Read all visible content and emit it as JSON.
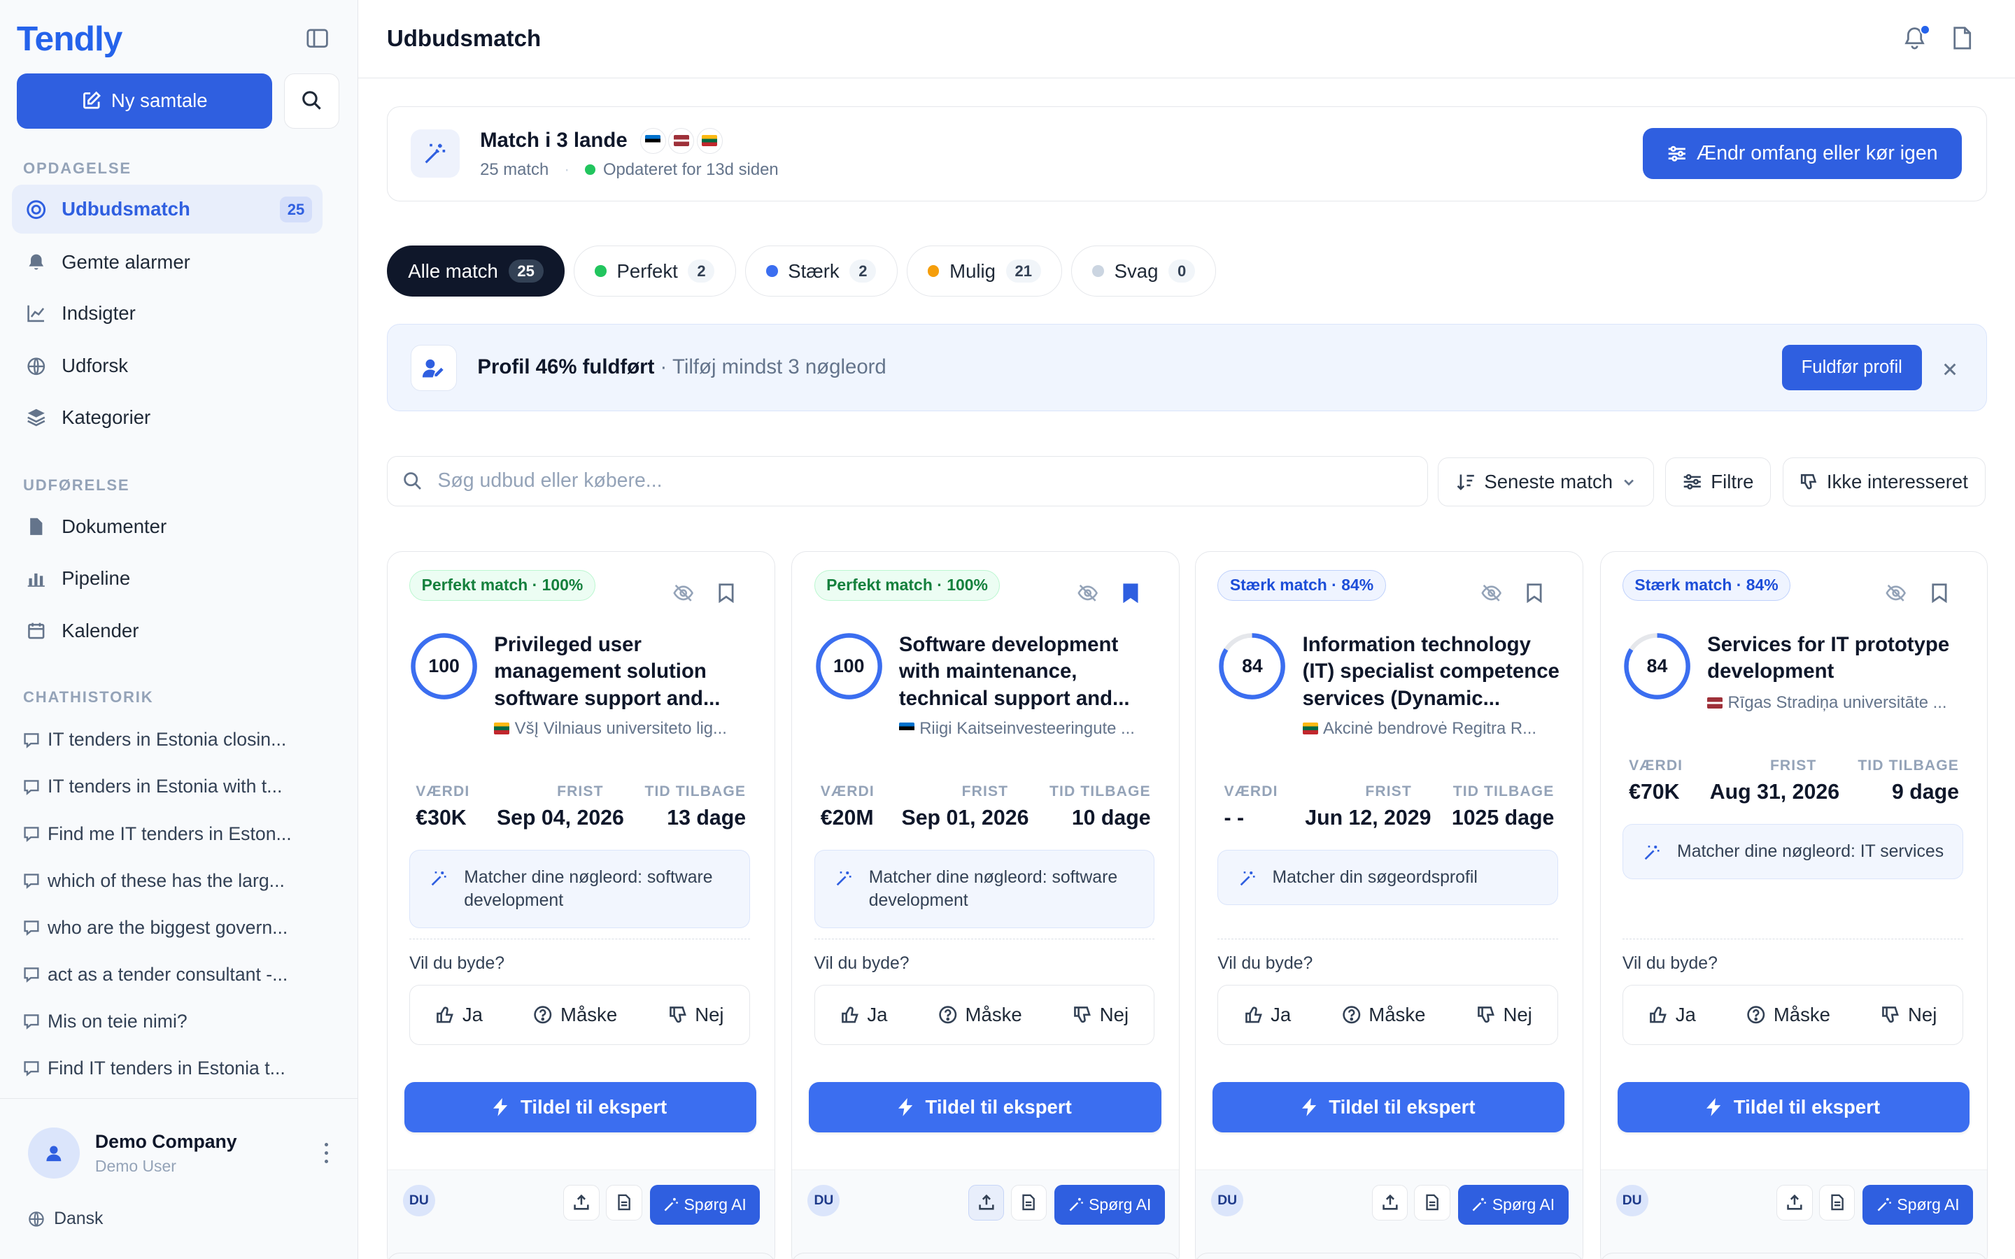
{
  "app": {
    "logo": "Tendly"
  },
  "sidebar": {
    "new_chat": "Ny samtale",
    "sections": {
      "discovery": "OPDAGELSE",
      "execution": "UDFØRELSE",
      "history": "CHATHISTORIK"
    },
    "nav": [
      {
        "label": "Udbudsmatch",
        "badge": "25",
        "icon": "target-icon"
      },
      {
        "label": "Gemte alarmer",
        "icon": "bell-icon"
      },
      {
        "label": "Indsigter",
        "icon": "line-chart-icon"
      },
      {
        "label": "Udforsk",
        "icon": "globe-icon"
      },
      {
        "label": "Kategorier",
        "icon": "layers-icon"
      }
    ],
    "exec_nav": [
      {
        "label": "Dokumenter",
        "icon": "document-icon"
      },
      {
        "label": "Pipeline",
        "icon": "bar-chart-icon"
      },
      {
        "label": "Kalender",
        "icon": "calendar-icon"
      }
    ],
    "history": [
      "IT tenders in Estonia closin...",
      "IT tenders in Estonia with t...",
      "Find me IT tenders in Eston...",
      "which of these has the larg...",
      "who are the biggest govern...",
      "act as a tender consultant -...",
      "Mis on teie nimi?",
      "Find IT tenders in Estonia t..."
    ],
    "footer": {
      "company": "Demo Company",
      "user": "Demo User",
      "language": "Dansk"
    }
  },
  "header": {
    "title": "Udbudsmatch"
  },
  "match_summary": {
    "title": "Match i 3 lande",
    "count": "25 match",
    "separator": "·",
    "updated": "Opdateret for 13d siden",
    "button": "Ændr omfang eller kør igen"
  },
  "filters": [
    {
      "label": "Alle match",
      "count": "25",
      "active": true
    },
    {
      "label": "Perfekt",
      "count": "2",
      "color": "#22c55e"
    },
    {
      "label": "Stærk",
      "count": "2",
      "color": "#3b6ef0"
    },
    {
      "label": "Mulig",
      "count": "21",
      "color": "#f59e0b"
    },
    {
      "label": "Svag",
      "count": "0",
      "color": "#cbd5e1"
    }
  ],
  "profile_banner": {
    "title": "Profil 46% fuldført",
    "subtitle": "· Tilføj mindst 3 nøgleord",
    "button": "Fuldfør  profil"
  },
  "toolbar": {
    "search_placeholder": "Søg udbud eller købere...",
    "sort": "Seneste match",
    "filters": "Filtre",
    "not_interested": "Ikke interesseret"
  },
  "card_labels": {
    "value": "VÆRDI",
    "deadline": "FRIST",
    "time_left": "TID TILBAGE",
    "question": "Vil du byde?",
    "yes": "Ja",
    "maybe": "Måske",
    "no": "Nej",
    "assign": "Tildel til ekspert",
    "avatar": "DU",
    "ask_ai": "Spørg AI"
  },
  "cards": [
    {
      "tag": "Perfekt match · 100%",
      "score": "100",
      "score_pct": 100,
      "title": "Privileged user management solution software support and...",
      "buyer": "VšĮ Vilniaus universiteto lig...",
      "value": "€30K",
      "deadline": "Sep 04, 2026",
      "time_left": "13 dage",
      "keywords": "Matcher dine nøgleord: software development",
      "bookmarked": false
    },
    {
      "tag": "Perfekt match · 100%",
      "score": "100",
      "score_pct": 100,
      "title": "Software development with maintenance, technical support and...",
      "buyer": "Riigi Kaitseinvesteeringute ...",
      "value": "€20M",
      "deadline": "Sep 01, 2026",
      "time_left": "10 dage",
      "keywords": "Matcher dine nøgleord: software development",
      "bookmarked": true
    },
    {
      "tag": "Stærk match · 84%",
      "score": "84",
      "score_pct": 84,
      "title": "Information technology (IT) specialist competence services (Dynamic...",
      "buyer": "Akcinė bendrovė Regitra  R...",
      "value": "- -",
      "deadline": "Jun 12, 2029",
      "time_left": "1025 dage",
      "keywords": "Matcher din søgeordsprofil",
      "bookmarked": false
    },
    {
      "tag": "Stærk match · 84%",
      "score": "84",
      "score_pct": 84,
      "title": "Services for IT prototype development",
      "buyer": "Rīgas Stradiņa universitāte ...",
      "value": "€70K",
      "deadline": "Aug 31, 2026",
      "time_left": "9 dage",
      "keywords": "Matcher dine nøgleord: IT services",
      "bookmarked": false
    }
  ],
  "colors": {
    "accent": "#2f5fe0",
    "perfect": "#15803d",
    "strong": "#1d4ed8"
  }
}
